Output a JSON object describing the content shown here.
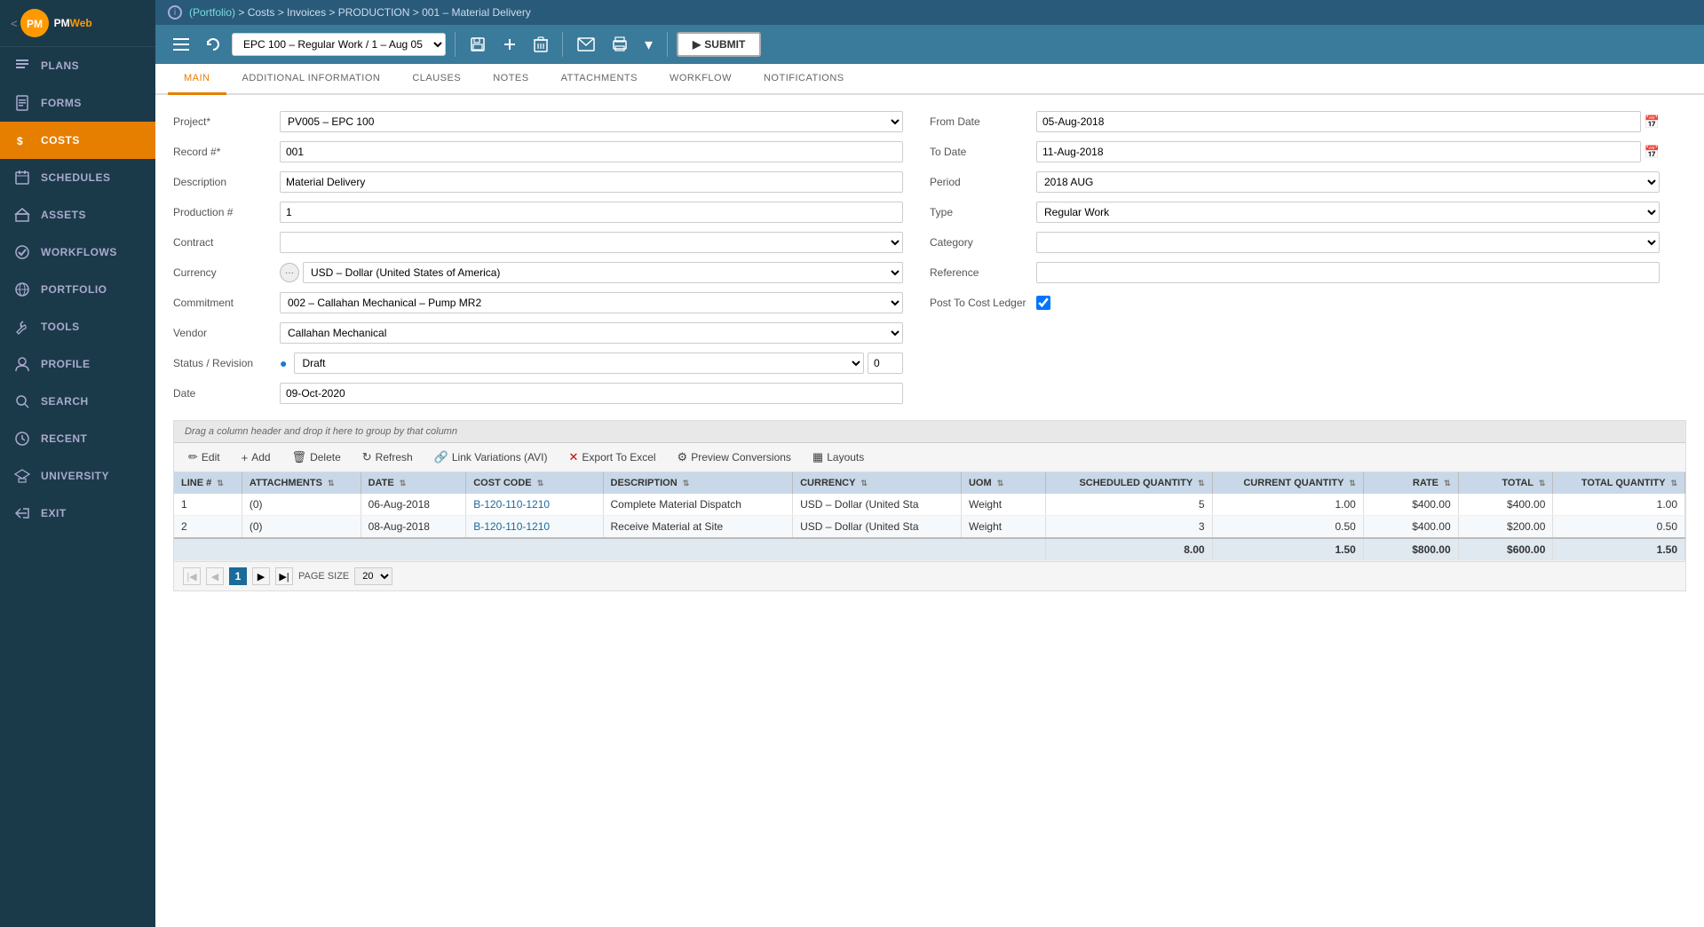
{
  "sidebar": {
    "logo": "PMWeb",
    "items": [
      {
        "id": "plans",
        "label": "PLANS",
        "icon": "📋",
        "active": false
      },
      {
        "id": "forms",
        "label": "FORMS",
        "icon": "📄",
        "active": false
      },
      {
        "id": "costs",
        "label": "COSTS",
        "icon": "💲",
        "active": true
      },
      {
        "id": "schedules",
        "label": "SCHEDULES",
        "icon": "📅",
        "active": false
      },
      {
        "id": "assets",
        "label": "ASSETS",
        "icon": "🏗",
        "active": false
      },
      {
        "id": "workflows",
        "label": "WORKFLOWS",
        "icon": "✔",
        "active": false
      },
      {
        "id": "portfolio",
        "label": "PORTFOLIO",
        "icon": "🌐",
        "active": false
      },
      {
        "id": "tools",
        "label": "TOOLS",
        "icon": "🔧",
        "active": false
      },
      {
        "id": "profile",
        "label": "PROFILE",
        "icon": "👤",
        "active": false
      },
      {
        "id": "search",
        "label": "SEARCH",
        "icon": "🔍",
        "active": false
      },
      {
        "id": "recent",
        "label": "RECENT",
        "icon": "🕐",
        "active": false
      },
      {
        "id": "university",
        "label": "UNIVERSITY",
        "icon": "🎓",
        "active": false
      },
      {
        "id": "exit",
        "label": "EXIT",
        "icon": "⬅",
        "active": false
      }
    ]
  },
  "topbar": {
    "breadcrumb": "(Portfolio) > Costs > Invoices > PRODUCTION > 001 – Material Delivery"
  },
  "toolbar": {
    "period_select": "EPC 100 – Regular Work / 1 – Aug 05",
    "submit_label": "SUBMIT"
  },
  "tabs": [
    {
      "id": "main",
      "label": "MAIN",
      "active": true
    },
    {
      "id": "additional",
      "label": "ADDITIONAL INFORMATION",
      "active": false
    },
    {
      "id": "clauses",
      "label": "CLAUSES",
      "active": false
    },
    {
      "id": "notes",
      "label": "NOTES",
      "active": false
    },
    {
      "id": "attachments",
      "label": "ATTACHMENTS",
      "active": false
    },
    {
      "id": "workflow",
      "label": "WORKFLOW",
      "active": false
    },
    {
      "id": "notifications",
      "label": "NOTIFICATIONS",
      "active": false
    }
  ],
  "page": {
    "title": "Material Delivery",
    "form": {
      "left": {
        "project_label": "Project*",
        "project_value": "PV005 – EPC 100",
        "record_label": "Record #*",
        "record_value": "001",
        "description_label": "Description",
        "description_value": "Material Delivery",
        "production_label": "Production #",
        "production_value": "1",
        "contract_label": "Contract",
        "contract_value": "",
        "currency_label": "Currency",
        "currency_value": "USD – Dollar (United States of America)",
        "commitment_label": "Commitment",
        "commitment_value": "002 – Callahan Mechanical – Pump MR2",
        "vendor_label": "Vendor",
        "vendor_value": "Callahan Mechanical",
        "status_label": "Status / Revision",
        "status_value": "Draft",
        "status_revision": "0",
        "date_label": "Date",
        "date_value": "09-Oct-2020"
      },
      "right": {
        "from_date_label": "From Date",
        "from_date_value": "05-Aug-2018",
        "to_date_label": "To Date",
        "to_date_value": "11-Aug-2018",
        "period_label": "Period",
        "period_value": "2018 AUG",
        "type_label": "Type",
        "type_value": "Regular Work",
        "category_label": "Category",
        "category_value": "",
        "reference_label": "Reference",
        "reference_value": "",
        "post_label": "Post To Cost Ledger",
        "post_checked": true
      }
    },
    "grid": {
      "drag_hint": "Drag a column header and drop it here to group by that column",
      "toolbar_buttons": [
        {
          "id": "edit",
          "label": "Edit",
          "icon": "✏"
        },
        {
          "id": "add",
          "label": "Add",
          "icon": "+"
        },
        {
          "id": "delete",
          "label": "Delete",
          "icon": "🗑"
        },
        {
          "id": "refresh",
          "label": "Refresh",
          "icon": "↻"
        },
        {
          "id": "link-variations",
          "label": "Link Variations (AVI)",
          "icon": "🔗"
        },
        {
          "id": "export",
          "label": "Export To Excel",
          "icon": "✕"
        },
        {
          "id": "preview",
          "label": "Preview Conversions",
          "icon": "⚙"
        },
        {
          "id": "layouts",
          "label": "Layouts",
          "icon": "▦"
        }
      ],
      "columns": [
        "LINE #",
        "ATTACHMENTS",
        "DATE",
        "COST CODE",
        "DESCRIPTION",
        "CURRENCY",
        "UOM",
        "SCHEDULED QUANTITY",
        "CURRENT QUANTITY",
        "RATE",
        "TOTAL",
        "TOTAL QUANTITY"
      ],
      "rows": [
        {
          "line": "1",
          "attachments": "(0)",
          "date": "06-Aug-2018",
          "cost_code": "B-120-110-1210",
          "description": "Complete Material Dispatch",
          "currency": "USD – Dollar (United Sta",
          "uom": "Weight",
          "scheduled_qty": "5",
          "current_qty": "1.00",
          "rate": "$400.00",
          "total": "$400.00",
          "total_qty": "1.00"
        },
        {
          "line": "2",
          "attachments": "(0)",
          "date": "08-Aug-2018",
          "cost_code": "B-120-110-1210",
          "description": "Receive Material at Site",
          "currency": "USD – Dollar (United Sta",
          "uom": "Weight",
          "scheduled_qty": "3",
          "current_qty": "0.50",
          "rate": "$400.00",
          "total": "$200.00",
          "total_qty": "0.50"
        }
      ],
      "totals": {
        "scheduled_qty": "8.00",
        "current_qty": "1.50",
        "rate": "$800.00",
        "total": "$600.00",
        "total_qty": "1.50"
      },
      "pagination": {
        "page": "1",
        "page_size": "20",
        "page_size_label": "PAGE SIZE"
      }
    }
  }
}
